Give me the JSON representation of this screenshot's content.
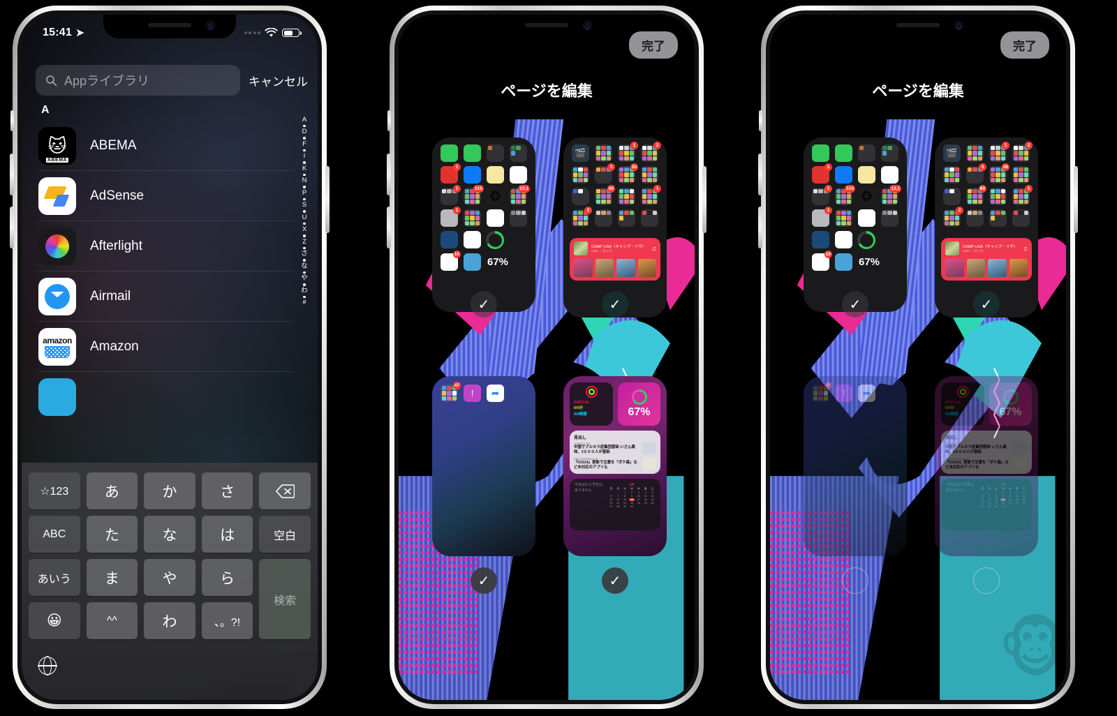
{
  "phone1": {
    "statusbar": {
      "time": "15:41",
      "location_glyph": "➤",
      "battery_level": "62"
    },
    "search": {
      "placeholder": "Appライブラリ",
      "value": "",
      "cancel_label": "キャンセル",
      "icon": "search-icon"
    },
    "section_letter": "A",
    "apps": [
      {
        "name": "ABEMA",
        "icon": "abema-icon",
        "glyph": "🐱",
        "tag": "ABEMA"
      },
      {
        "name": "AdSense",
        "icon": "adsense-icon"
      },
      {
        "name": "Afterlight",
        "icon": "afterlight-icon"
      },
      {
        "name": "Airmail",
        "icon": "airmail-icon"
      },
      {
        "name": "Amazon",
        "icon": "amazon-icon",
        "wordmark": "amazon"
      }
    ],
    "index_letters": [
      "A",
      "D",
      "F",
      "I",
      "K",
      "N",
      "P",
      "S",
      "U",
      "X",
      "Z",
      "さ",
      "な",
      "や",
      "わ",
      "#"
    ],
    "keyboard": {
      "rows": [
        [
          "☆123",
          "あ",
          "か",
          "さ",
          "⌫"
        ],
        [
          "ABC",
          "た",
          "な",
          "は",
          "空白"
        ],
        [
          "あいう",
          "ま",
          "や",
          "ら",
          "検索"
        ],
        [
          "😀",
          "^^",
          "わ",
          "、。?!"
        ]
      ],
      "search_key": "検索",
      "globe_icon": "globe-icon"
    }
  },
  "phone2": {
    "done_label": "完了",
    "title": "ページを編集",
    "battery_pct": "67%",
    "pages": [
      {
        "id": "page-1",
        "selected": true,
        "type": "apps"
      },
      {
        "id": "page-2",
        "selected": true,
        "type": "folders"
      },
      {
        "id": "page-3",
        "selected": true,
        "type": "sparse"
      },
      {
        "id": "page-4",
        "selected": true,
        "type": "widgets"
      }
    ],
    "music_widget": {
      "title": "CAMP LiSA（キャンプ・リサ）",
      "subtitle": "LiSA — ロック"
    },
    "activity_widget": {
      "lines": [
        "0/0KCAL",
        "0/0分",
        "0/0時間"
      ]
    },
    "news_widget": {
      "header": "見出し",
      "items": [
        {
          "source": "SANKEI.COM",
          "title": "中国でブルセラ症集団感染 いさん腐味、3０００人が感染"
        },
        {
          "source": "WATCHIMPRESS.JP",
          "title": "『iOS14』更新で注意を「ポケ森」など未対応のアプリも"
        }
      ]
    },
    "calendar_widget": {
      "empty_text": "今日はもう予定はありません",
      "month": "9月",
      "weekdays": [
        "日",
        "月",
        "火",
        "水",
        "木",
        "金",
        "土"
      ],
      "today": "16"
    },
    "checkmark_glyph": "✓"
  },
  "phone3": {
    "done_label": "完了",
    "title": "ページを編集",
    "battery_pct": "67%",
    "pages": [
      {
        "id": "page-1",
        "selected": true,
        "type": "apps"
      },
      {
        "id": "page-2",
        "selected": true,
        "type": "folders"
      },
      {
        "id": "page-3",
        "selected": false,
        "type": "sparse"
      },
      {
        "id": "page-4",
        "selected": false,
        "type": "widgets"
      }
    ],
    "checkmark_glyph": "✓"
  },
  "watermark": {
    "name": "monkey-logo",
    "glyph": "🐵"
  },
  "colors": {
    "accent_red": "#ff3b30",
    "battery_green": "#30d158",
    "music_red": "#f0384f",
    "page_blue": "#3b3f96",
    "page_purple": "#6b2168"
  }
}
